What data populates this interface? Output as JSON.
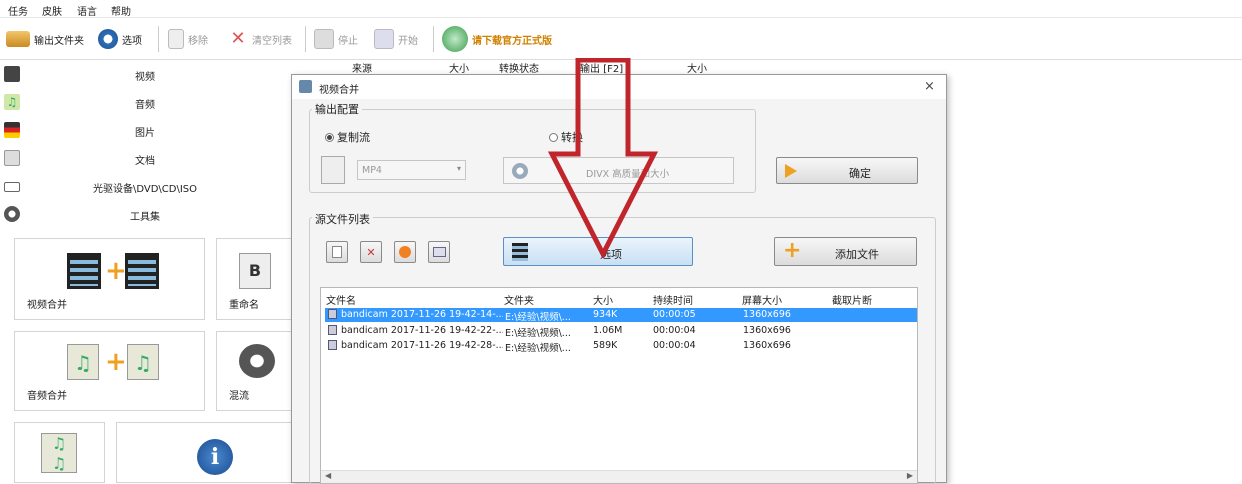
{
  "menubar": {
    "items": [
      "任务",
      "皮肤",
      "语言",
      "帮助"
    ]
  },
  "toolbar": {
    "output_folder": "输出文件夹",
    "options": "选项",
    "remove": "移除",
    "clear_list": "清空列表",
    "stop": "停止",
    "start": "开始",
    "download": "请下载官方正式版"
  },
  "categories": [
    "视频",
    "音频",
    "图片",
    "文档",
    "光驱设备\\DVD\\CD\\ISO",
    "工具集"
  ],
  "tiles": {
    "video_merge": "视频合并",
    "rename": "重命名",
    "audio_merge": "音频合并",
    "mix": "混流"
  },
  "task_columns": [
    "来源",
    "大小",
    "转换状态",
    "输出 [F2]",
    "大小"
  ],
  "dialog": {
    "title": "视频合并",
    "output_config": "输出配置",
    "copy_stream": "复制流",
    "convert": "转换",
    "format": "MP4",
    "quality": "DIVX 高质量和大小",
    "ok": "确定",
    "source_list": "源文件列表",
    "options": "选项",
    "add_file": "添加文件",
    "columns": [
      "文件名",
      "文件夹",
      "大小",
      "持续时间",
      "屏幕大小",
      "截取片断"
    ],
    "rows": [
      {
        "name": "bandicam 2017-11-26 19-42-14-...",
        "folder": "E:\\经验\\视频\\...",
        "size": "934K",
        "duration": "00:00:05",
        "screen": "1360x696"
      },
      {
        "name": "bandicam 2017-11-26 19-42-22-...",
        "folder": "E:\\经验\\视频\\...",
        "size": "1.06M",
        "duration": "00:00:04",
        "screen": "1360x696"
      },
      {
        "name": "bandicam 2017-11-26 19-42-28-...",
        "folder": "E:\\经验\\视频\\...",
        "size": "589K",
        "duration": "00:00:04",
        "screen": "1360x696"
      }
    ]
  },
  "colors": {
    "arrow": "#c0252b",
    "selection": "#3399ff",
    "accent": "#f0a020"
  }
}
